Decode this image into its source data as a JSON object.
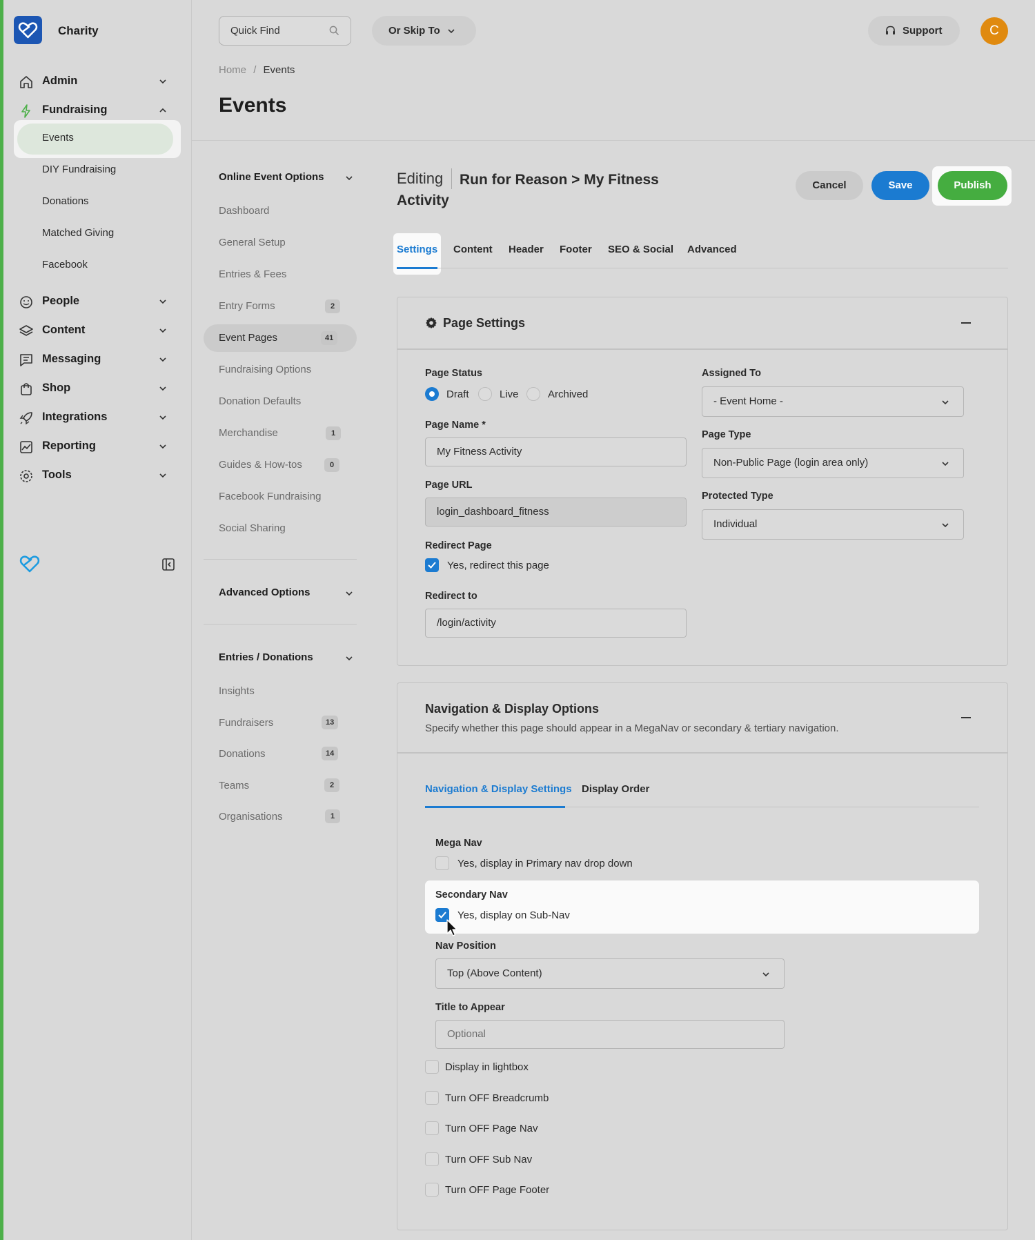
{
  "app": {
    "brand": "Charity"
  },
  "sidebar": {
    "admin": "Admin",
    "fundraising": "Fundraising",
    "sub_items": [
      "Events",
      "DIY Fundraising",
      "Donations",
      "Matched Giving",
      "Facebook"
    ],
    "people": "People",
    "content": "Content",
    "messaging": "Messaging",
    "shop": "Shop",
    "integrations": "Integrations",
    "reporting": "Reporting",
    "tools": "Tools"
  },
  "topbar": {
    "quick_find": "Quick Find",
    "skip_to": "Or Skip To",
    "support": "Support",
    "avatar_initial": "C"
  },
  "breadcrumb": {
    "home": "Home",
    "sep": "/",
    "current": "Events"
  },
  "page_title": "Events",
  "left_sections": {
    "online": {
      "title": "Online Event Options",
      "items": [
        {
          "label": "Dashboard",
          "badge": ""
        },
        {
          "label": "General Setup",
          "badge": ""
        },
        {
          "label": "Entries & Fees",
          "badge": ""
        },
        {
          "label": "Entry Forms",
          "badge": "2"
        },
        {
          "label": "Event Pages",
          "badge": "41"
        },
        {
          "label": "Fundraising Options",
          "badge": ""
        },
        {
          "label": "Donation Defaults",
          "badge": ""
        },
        {
          "label": "Merchandise",
          "badge": "1"
        },
        {
          "label": "Guides & How-tos",
          "badge": "0"
        },
        {
          "label": "Facebook Fundraising",
          "badge": ""
        },
        {
          "label": "Social Sharing",
          "badge": ""
        }
      ]
    },
    "advanced": {
      "title": "Advanced Options"
    },
    "entries": {
      "title": "Entries / Donations",
      "items": [
        {
          "label": "Insights",
          "badge": ""
        },
        {
          "label": "Fundraisers",
          "badge": "13"
        },
        {
          "label": "Donations",
          "badge": "14"
        },
        {
          "label": "Teams",
          "badge": "2"
        },
        {
          "label": "Organisations",
          "badge": "1"
        }
      ]
    }
  },
  "editor": {
    "editing_label": "Editing",
    "title": "Run for Reason > My Fitness Activity",
    "cancel": "Cancel",
    "save": "Save",
    "publish": "Publish",
    "tabs": [
      "Settings",
      "Content",
      "Header",
      "Footer",
      "SEO & Social",
      "Advanced"
    ]
  },
  "page_settings": {
    "title": "Page Settings",
    "page_status_label": "Page Status",
    "status_options": [
      "Draft",
      "Live",
      "Archived"
    ],
    "selected_status": "Draft",
    "page_name_label": "Page Name *",
    "page_name_value": "My Fitness Activity",
    "page_url_label": "Page URL",
    "page_url_value": "login_dashboard_fitness",
    "redirect_label": "Redirect Page",
    "redirect_checkbox": "Yes, redirect this page",
    "redirect_to_label": "Redirect to",
    "redirect_to_value": "/login/activity",
    "assigned_label": "Assigned To",
    "assigned_value": "- Event Home -",
    "page_type_label": "Page Type",
    "page_type_value": "Non-Public Page (login area only)",
    "protected_label": "Protected Type",
    "protected_value": "Individual"
  },
  "nav_display": {
    "title": "Navigation & Display Options",
    "description": "Specify whether this page should appear in a MegaNav or secondary & tertiary navigation.",
    "subtabs": [
      "Navigation & Display Settings",
      "Display Order"
    ],
    "mega_nav_label": "Mega Nav",
    "mega_nav_checkbox": "Yes, display in Primary nav drop down",
    "secondary_nav_label": "Secondary Nav",
    "secondary_nav_checkbox": "Yes, display on Sub-Nav",
    "nav_position_label": "Nav Position",
    "nav_position_value": "Top (Above Content)",
    "title_to_appear_label": "Title to Appear",
    "title_to_appear_placeholder": "Optional",
    "options": [
      "Display in lightbox",
      "Turn OFF Breadcrumb",
      "Turn OFF Page Nav",
      "Turn OFF Sub Nav",
      "Turn OFF Page Footer"
    ]
  },
  "colors": {
    "accent": "#1b7bd1",
    "publish": "#45ad40",
    "brand": "#1c56b3",
    "avatar": "#e08a0f"
  }
}
